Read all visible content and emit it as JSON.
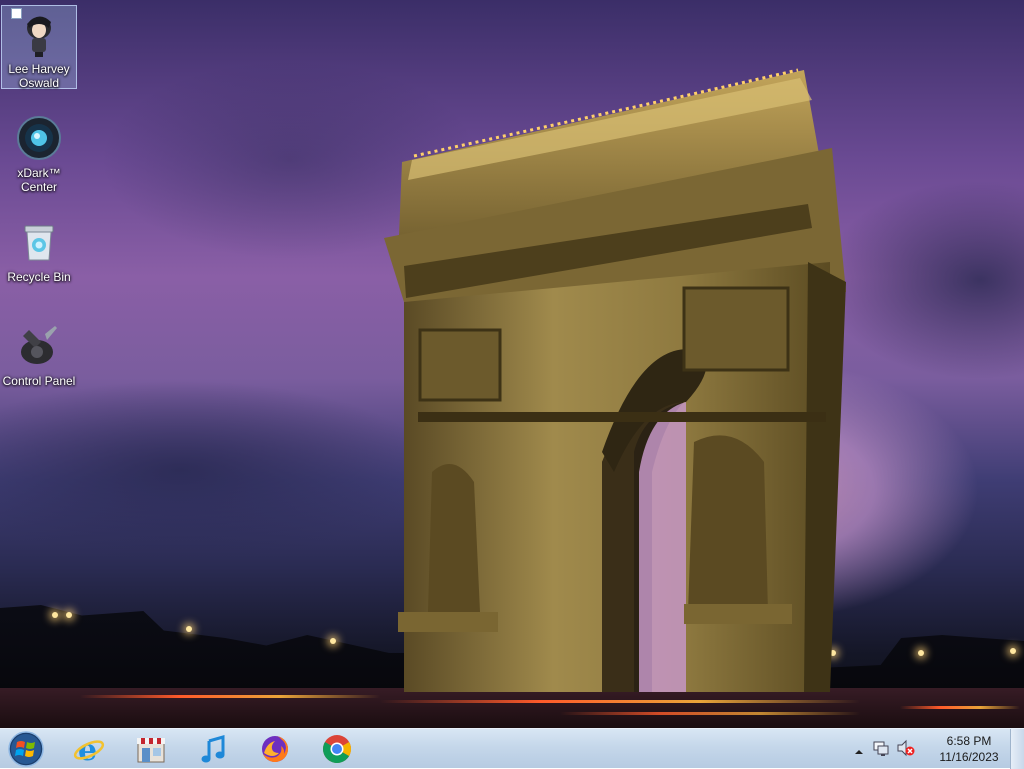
{
  "desktop": {
    "icons": [
      {
        "label": "Lee Harvey\nOswald",
        "icon": "user-folder-icon"
      },
      {
        "label": "xDark™\nCenter",
        "icon": "xdark-center-icon"
      },
      {
        "label": "Recycle Bin",
        "icon": "recycle-bin-icon"
      },
      {
        "label": "Control Panel",
        "icon": "control-panel-icon"
      }
    ]
  },
  "taskbar": {
    "start_icon": "windows-start-orb-icon",
    "apps": [
      {
        "name": "Internet Explorer",
        "icon": "internet-explorer-icon"
      },
      {
        "name": "Store",
        "icon": "store-icon"
      },
      {
        "name": "iTunes",
        "icon": "itunes-icon"
      },
      {
        "name": "Firefox",
        "icon": "firefox-icon"
      },
      {
        "name": "Google Chrome",
        "icon": "chrome-icon"
      }
    ],
    "tray": {
      "overflow_icon": "chevron-up-icon",
      "network_icon": "network-icon",
      "volume_icon": "volume-muted-icon"
    },
    "clock": {
      "time": "6:58 PM",
      "date": "11/16/2023"
    }
  },
  "colors": {
    "taskbar_top": "#d8e6f4",
    "taskbar_bottom": "#b6cbe2",
    "sky_purple": "#8a5fa6"
  }
}
